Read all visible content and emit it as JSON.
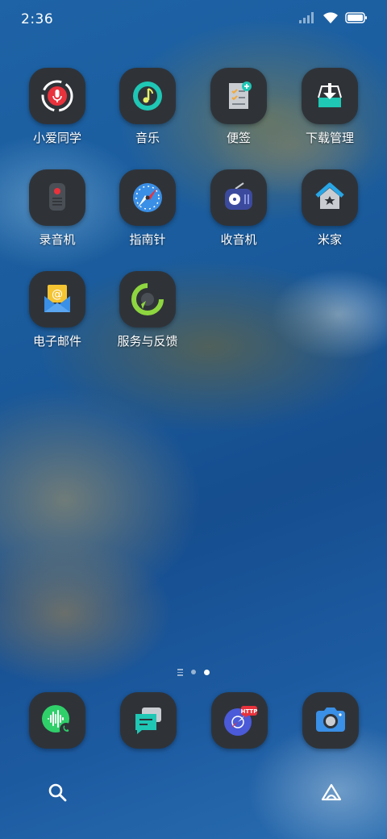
{
  "status_bar": {
    "time": "2:36",
    "icons": [
      "signal-icon",
      "wifi-icon",
      "battery-icon"
    ]
  },
  "apps": [
    {
      "label": "小爱同学",
      "icon": "xiaoai-icon"
    },
    {
      "label": "音乐",
      "icon": "music-icon"
    },
    {
      "label": "便签",
      "icon": "notes-icon"
    },
    {
      "label": "下载管理",
      "icon": "download-icon"
    },
    {
      "label": "录音机",
      "icon": "recorder-icon"
    },
    {
      "label": "指南针",
      "icon": "compass-icon"
    },
    {
      "label": "收音机",
      "icon": "radio-icon"
    },
    {
      "label": "米家",
      "icon": "mihome-icon"
    },
    {
      "label": "电子邮件",
      "icon": "email-icon"
    },
    {
      "label": "服务与反馈",
      "icon": "service-feedback-icon"
    }
  ],
  "page_indicator": {
    "pages": 2,
    "current": 2
  },
  "dock": [
    {
      "icon": "phone-icon"
    },
    {
      "icon": "messages-icon"
    },
    {
      "icon": "browser-icon"
    },
    {
      "icon": "camera-icon"
    }
  ],
  "bottom_bar": {
    "icons": [
      "search-icon",
      "assistant-icon"
    ]
  },
  "colors": {
    "icon_background": "#2f3338",
    "accent_red": "#e8323c",
    "accent_teal": "#1fc7b5",
    "accent_blue": "#3a8fe6"
  }
}
